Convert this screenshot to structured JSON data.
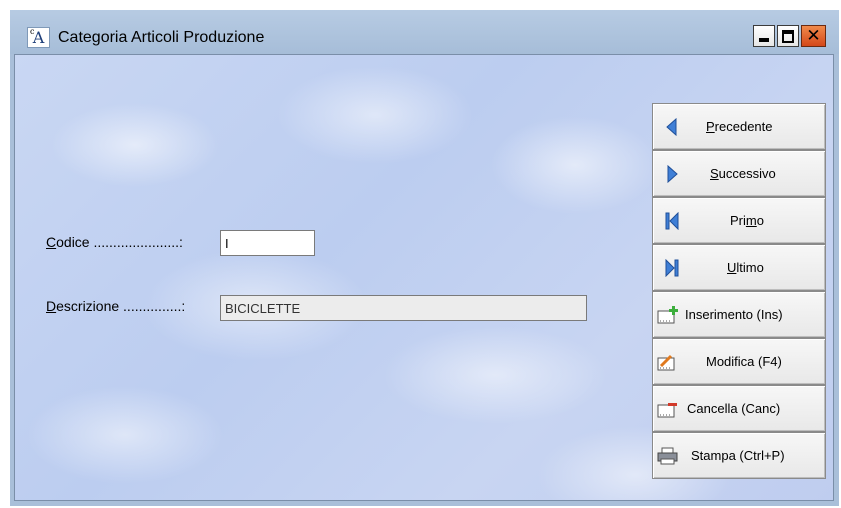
{
  "window": {
    "title": "Categoria Articoli Produzione",
    "icon": "app-letter-a-icon",
    "controls": [
      "minimize-icon",
      "maximize-icon",
      "close-icon"
    ],
    "close_glyph": "✕"
  },
  "form": {
    "codice": {
      "label_prefix": "C",
      "label_rest": "odice ......................:",
      "value": "I"
    },
    "descrizione": {
      "label_prefix": "D",
      "label_rest": "escrizione ...............:",
      "value": "BICICLETTE"
    }
  },
  "buttons": {
    "precedente": {
      "mnemonic": "P",
      "rest": "recedente",
      "icon": "arrow-left-icon"
    },
    "successivo": {
      "mnemonic": "S",
      "rest": "uccessivo",
      "icon": "arrow-right-icon"
    },
    "primo": {
      "pre": "Pri",
      "mnemonic": "m",
      "rest": "o",
      "icon": "first-record-icon"
    },
    "ultimo": {
      "mnemonic": "U",
      "rest": "ltimo",
      "icon": "last-record-icon"
    },
    "inserimento": {
      "label": "Inserimento (Ins)",
      "icon": "insert-record-icon"
    },
    "modifica": {
      "label": "Modifica (F4)",
      "icon": "edit-record-icon"
    },
    "cancella": {
      "label": "Cancella (Canc)",
      "icon": "delete-record-icon"
    },
    "stampa": {
      "label": "Stampa (Ctrl+P)",
      "icon": "printer-icon"
    }
  },
  "colors": {
    "accent_blue": "#3f7fd6",
    "close_button": "#e06a2f",
    "insert_green": "#3cae3c"
  }
}
